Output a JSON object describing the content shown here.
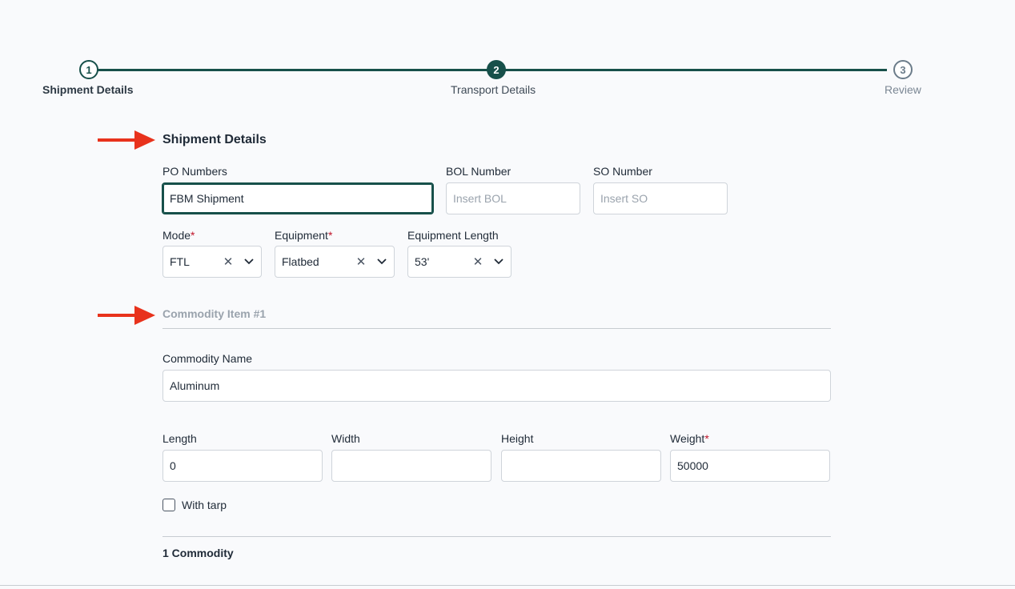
{
  "stepper": {
    "steps": [
      {
        "number": "1",
        "label": "Shipment Details",
        "state": "done"
      },
      {
        "number": "2",
        "label": "Transport Details",
        "state": "active"
      },
      {
        "number": "3",
        "label": "Review",
        "state": "pending"
      }
    ]
  },
  "shipment": {
    "title": "Shipment Details",
    "po_label": "PO Numbers",
    "po_value": "FBM Shipment",
    "bol_label": "BOL Number",
    "bol_placeholder": "Insert BOL",
    "so_label": "SO Number",
    "so_placeholder": "Insert SO",
    "mode_label": "Mode",
    "mode_value": "FTL",
    "equipment_label": "Equipment",
    "equipment_value": "Flatbed",
    "equipment_length_label": "Equipment Length",
    "equipment_length_value": "53'",
    "required_mark": "*"
  },
  "commodity": {
    "title": "Commodity Item #1",
    "name_label": "Commodity Name",
    "name_value": "Aluminum",
    "length_label": "Length",
    "length_value": "0",
    "width_label": "Width",
    "width_value": "",
    "height_label": "Height",
    "height_value": "",
    "weight_label": "Weight",
    "weight_value": "50000",
    "tarp_label": "With tarp",
    "tarp_checked": false
  },
  "summary": {
    "count_label": "1 Commodity"
  },
  "colors": {
    "accent": "#17504a",
    "arrow": "#e8321c",
    "required": "#c0162b"
  }
}
